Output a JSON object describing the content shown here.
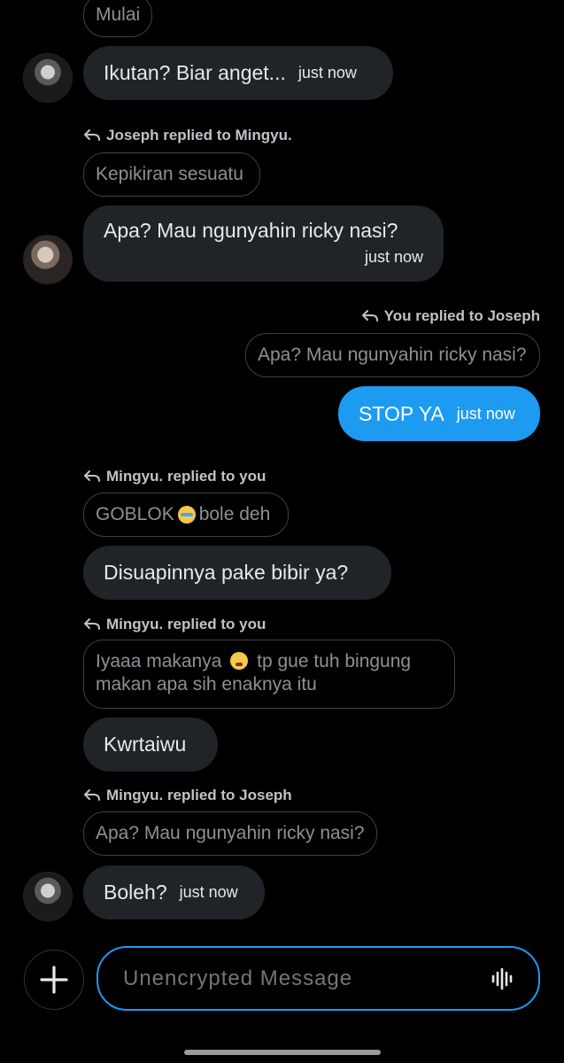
{
  "messages": [
    {
      "quote": "Mulai"
    },
    {
      "bubble": "Ikutan? Biar anget...",
      "time": "just now"
    },
    {
      "reply_label": "Joseph replied to Mingyu.",
      "quote": "Kepikiran sesuatu",
      "bubble": "Apa? Mau ngunyahin ricky nasi?",
      "time": "just now"
    },
    {
      "reply_label": "You replied to Joseph",
      "quote": "Apa? Mau ngunyahin ricky nasi?",
      "bubble": "STOP YA",
      "time": "just now"
    },
    {
      "reply_label": "Mingyu. replied to you",
      "quote_pre": "GOBLOK",
      "quote_post": "bole deh",
      "bubble": "Disuapinnya pake bibir ya?"
    },
    {
      "reply_label": "Mingyu. replied to you",
      "quote_line1_pre": "Iyaaa makanya",
      "quote_line1_post": "tp gue tuh bingung",
      "quote_line2": "makan apa sih enaknya itu",
      "bubble": "Kwrtaiwu"
    },
    {
      "reply_label": "Mingyu. replied to Joseph",
      "quote": "Apa? Mau ngunyahin ricky nasi?",
      "bubble": "Boleh?",
      "time": "just now"
    }
  ],
  "composer": {
    "placeholder": "Unencrypted Message"
  },
  "colors": {
    "background": "#000000",
    "accent": "#1d9bf0",
    "bubble": "#202327"
  }
}
